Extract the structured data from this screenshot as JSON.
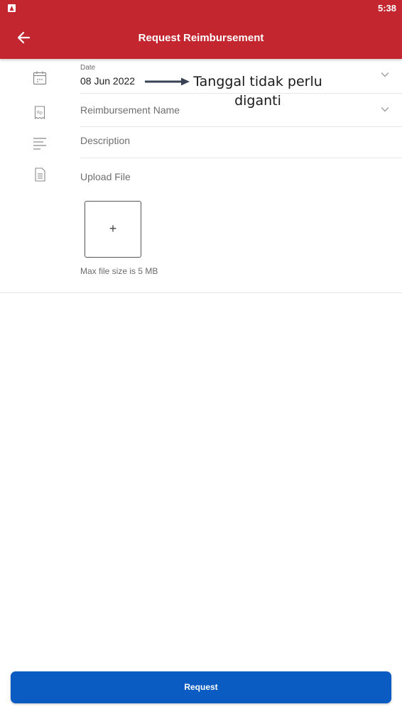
{
  "status_bar": {
    "time": "5:38",
    "notification_icon": "app-notification-icon"
  },
  "header": {
    "title": "Request Reimbursement",
    "back_icon": "arrow-left-icon"
  },
  "form": {
    "date": {
      "label": "Date",
      "value": "08 Jun 2022",
      "icon": "calendar-icon"
    },
    "reimbursement_name": {
      "placeholder": "Reimbursement Name",
      "icon": "receipt-rp-icon"
    },
    "description": {
      "placeholder": "Description",
      "icon": "lines-icon"
    },
    "upload": {
      "label": "Upload File",
      "add_symbol": "+",
      "hint": "Max file size is 5 MB",
      "icon": "document-icon"
    }
  },
  "annotation": {
    "line1": "Tanggal tidak perlu",
    "line2": "diganti"
  },
  "footer": {
    "button_label": "Request"
  },
  "colors": {
    "primary_red": "#c3262f",
    "button_blue": "#0a5cc2"
  }
}
